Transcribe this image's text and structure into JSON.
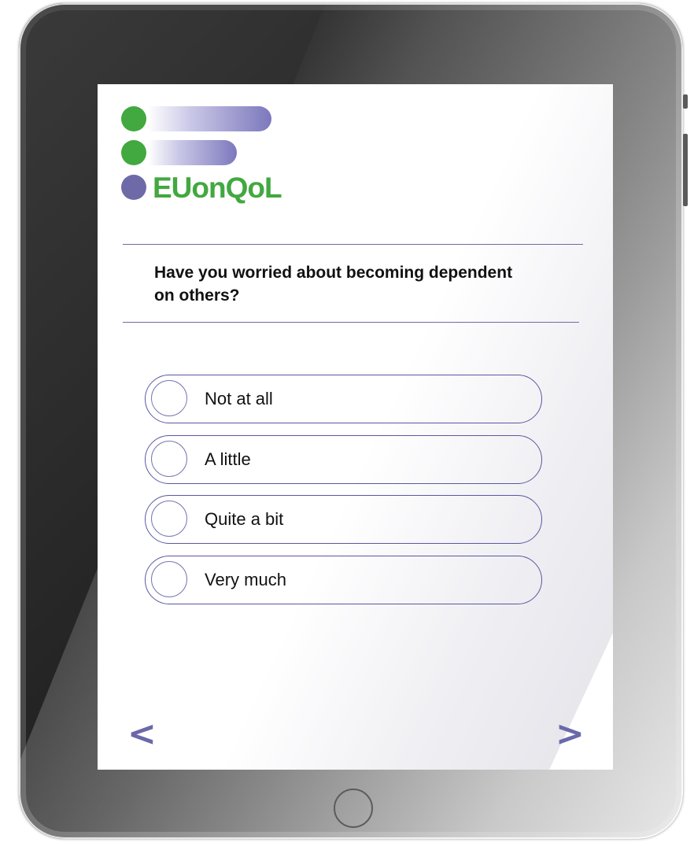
{
  "app": {
    "logo_text": "EUonQoL"
  },
  "question": {
    "text": "Have you worried about becoming dependent on others?"
  },
  "options": [
    {
      "label": "Not at all"
    },
    {
      "label": "A little"
    },
    {
      "label": "Quite a bit"
    },
    {
      "label": "Very much"
    }
  ],
  "navigation": {
    "back_glyph": "<",
    "next_glyph": ">"
  },
  "icons": {
    "back": "chevron-left-icon",
    "next": "chevron-right-icon",
    "radio": "radio-circle-icon",
    "home": "home-button-icon"
  },
  "colors": {
    "brand_green": "#42a840",
    "brand_purple": "#6e6aa8",
    "option_border": "#5b57a0",
    "nav_arrow": "#6b68aa"
  }
}
